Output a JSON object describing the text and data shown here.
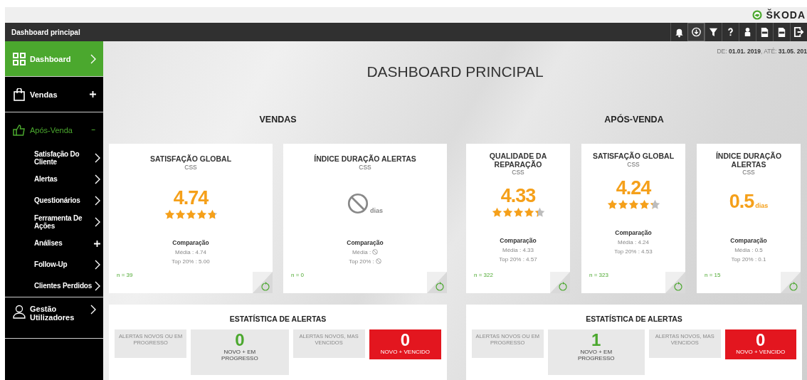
{
  "brand": {
    "name": "ŠKODA"
  },
  "topbar": {
    "title": "Dashboard principal"
  },
  "sidebar": {
    "items": [
      {
        "label": "Dashboard",
        "kind": "link",
        "selected": true
      },
      {
        "label": "Vendas",
        "kind": "group",
        "expanded": false,
        "selected": false
      },
      {
        "label": "Após-Venda",
        "kind": "group",
        "expanded": true,
        "selected": false,
        "children": [
          {
            "label": "Satisfação Do Cliente",
            "kind": "link"
          },
          {
            "label": "Alertas",
            "kind": "link"
          },
          {
            "label": "Questionários",
            "kind": "link"
          },
          {
            "label": "Ferramenta De Ações",
            "kind": "link"
          },
          {
            "label": "Análises",
            "kind": "group",
            "expanded": false
          },
          {
            "label": "Follow-Up",
            "kind": "link"
          },
          {
            "label": "Clientes Perdidos",
            "kind": "link"
          }
        ]
      },
      {
        "label": "Gestão Utilizadores",
        "kind": "link",
        "selected": false
      }
    ]
  },
  "date_range": "DE: **01.01. 2019**, ATÉ: **31.05. 201**",
  "title": "DASHBOARD PRINCIPAL",
  "sections": [
    {
      "heading": "VENDAS",
      "cards": [
        {
          "kind": "rating",
          "title": "SATISFAÇÃO GLOBAL",
          "subtitle": "CSS",
          "no_data": false,
          "value": "4.74",
          "stars": 4.74,
          "comparison": "Comparação",
          "average": "Média : 4.74",
          "top": "Top 20% : 5.00",
          "n": "n = 39"
        },
        {
          "kind": "duration",
          "title": "ÍNDICE DURAÇÃO ALERTAS",
          "subtitle": "CSS",
          "no_data": true,
          "unit": "dias",
          "comparison": "Comparação",
          "average": "Média :",
          "top": "Top 20% :",
          "n": "n = 0"
        }
      ],
      "alerts": {
        "title": "ESTATÍSTICA DE ALERTAS",
        "tiles": [
          {
            "kind": "label",
            "text": "ALERTAS NOVOS OU EM PROGRESSO"
          },
          {
            "kind": "count",
            "count": "0",
            "text": "NOVO + EM PROGRESSO"
          },
          {
            "kind": "label",
            "text": "ALERTAS NOVOS, MAS VENCIDOS"
          },
          {
            "kind": "count_overdue",
            "count": "0",
            "text": "NOVO + VENCIDO"
          }
        ]
      }
    },
    {
      "heading": "APÓS-VENDA",
      "cards": [
        {
          "kind": "rating",
          "title": "QUALIDADE DA REPARAÇÃO",
          "subtitle": "CSS",
          "no_data": false,
          "value": "4.33",
          "stars": 4.33,
          "comparison": "Comparação",
          "average": "Média : 4.33",
          "top": "Top 20% : 4.57",
          "n": "n = 322"
        },
        {
          "kind": "rating",
          "title": "SATISFAÇÃO GLOBAL",
          "subtitle": "CSS",
          "no_data": false,
          "value": "4.24",
          "stars": 4.24,
          "comparison": "Comparação",
          "average": "Média : 4.24",
          "top": "Top 20% : 4.53",
          "n": "n = 323"
        },
        {
          "kind": "duration",
          "title": "ÍNDICE DURAÇÃO ALERTAS",
          "subtitle": "CSS",
          "no_data": false,
          "value": "0.5",
          "unit": "dias",
          "comparison": "Comparação",
          "average": "Média : 0.5",
          "top": "Top 20% : 0.1",
          "n": "n = 15"
        }
      ],
      "alerts": {
        "title": "ESTATÍSTICA DE ALERTAS",
        "tiles": [
          {
            "kind": "label",
            "text": "ALERTAS NOVOS OU EM PROGRESSO"
          },
          {
            "kind": "count",
            "count": "1",
            "text": "NOVO + EM PROGRESSO"
          },
          {
            "kind": "label",
            "text": "ALERTAS NOVOS, MAS VENCIDOS"
          },
          {
            "kind": "count_overdue",
            "count": "0",
            "text": "NOVO + VENCIDO"
          }
        ]
      }
    }
  ]
}
